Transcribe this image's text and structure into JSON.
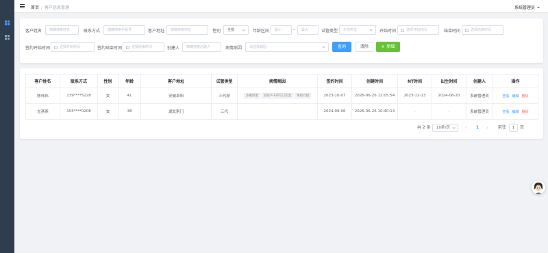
{
  "header": {
    "breadcrumb_home": "首页",
    "breadcrumb_current": "客户信息管理",
    "user": "系统管理员"
  },
  "search": {
    "fields": {
      "name_label": "客户姓名",
      "name_placeholder": "模糊搜索姓名",
      "phone_label": "联系方式",
      "phone_placeholder": "模糊搜索手机号",
      "address_label": "客户地址",
      "address_placeholder": "模糊搜索地址",
      "gender_label": "性别",
      "gender_value": "全部",
      "age_label": "年龄区间",
      "age_min_placeholder": "最小",
      "age_max_placeholder": "最大",
      "trial_label": "试管类型",
      "trial_placeholder": "全部类型",
      "start_label": "开始时间",
      "start_placeholder": "选择开始时间",
      "end_label": "结束时间",
      "end_placeholder": "选择结束时间",
      "sign_start_label": "签约开始时间",
      "sign_start_placeholder": "选择开始时间",
      "sign_end_label": "签约结束时间",
      "sign_end_placeholder": "选择结束时间",
      "creator_label": "创建人",
      "creator_placeholder": "模糊搜索创建人",
      "disease_label": "病情病因",
      "disease_placeholder": "请选择病因"
    },
    "query_button": "查询",
    "clear_button": "清除",
    "add_button": "新增",
    "add_icon_glyph": "+"
  },
  "table": {
    "columns": [
      "客户姓名",
      "联系方式",
      "性别",
      "年龄",
      "客户地址",
      "试管类型",
      "病情病因",
      "签约时间",
      "创建时间",
      "NT时间",
      "出生时间",
      "创建人",
      "操作"
    ],
    "rows": [
      {
        "name": "陈伟伟",
        "phone": "139****5228",
        "gender": "女",
        "age": "41",
        "address": "安徽阜阳",
        "trial": "三代卵",
        "tags": [
          "多囊卵巢",
          "前胎产子存在口腔室",
          "免疫问题"
        ],
        "sign_time": "2023-10-07",
        "create_time": "2026-06-26 12:05:54",
        "nt_time": "2023-12-13",
        "birth_time": "2024-06-20",
        "creator": "系统管理员",
        "ops": [
          "查看",
          "编辑",
          "删除"
        ]
      },
      {
        "name": "左燕燕",
        "phone": "155****0208",
        "gender": "女",
        "age": "38",
        "address": "湖北荆门",
        "trial": "三代",
        "tags": [],
        "sign_time": "2024-09-06",
        "create_time": "2026-06-26 10:40:13",
        "nt_time": "-",
        "birth_time": "-",
        "creator": "系统管理员",
        "ops": [
          "查看",
          "编辑",
          "删除"
        ]
      }
    ]
  },
  "pagination": {
    "total": "共 2 条",
    "page_size": "10条/页",
    "prev": "‹",
    "current": "1",
    "next": "›",
    "goto_label": "前往",
    "goto_value": "1",
    "page_suffix": "页"
  }
}
